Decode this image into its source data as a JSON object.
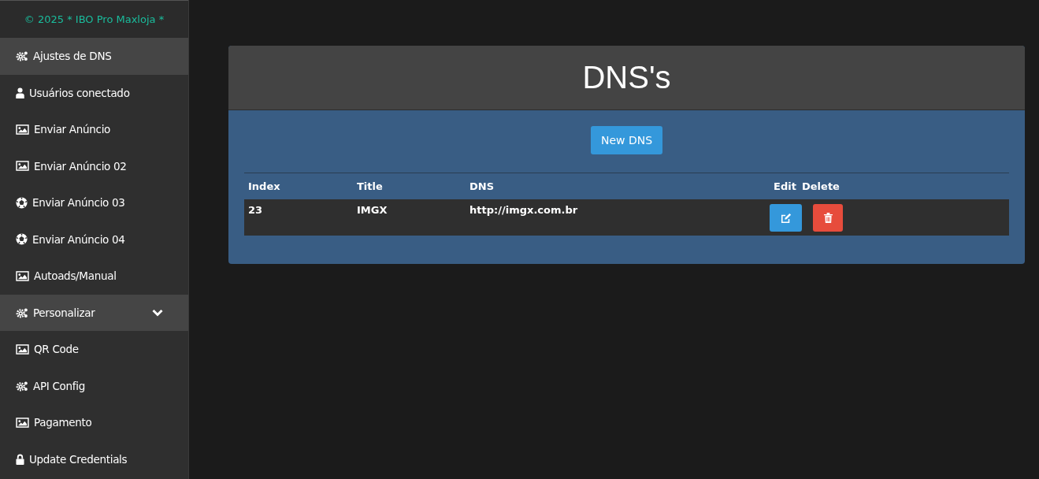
{
  "sidebar": {
    "brand": "© 2025 * IBO Pro Maxloja *",
    "items": [
      {
        "label": "Ajustes de DNS",
        "kind": "gears",
        "selected": true
      },
      {
        "label": "Usuários conectado",
        "kind": "user",
        "selected": false
      },
      {
        "label": "Enviar Anúncio",
        "kind": "image",
        "selected": false
      },
      {
        "label": "Enviar Anúncio 02",
        "kind": "image",
        "selected": false
      },
      {
        "label": "Enviar Anúncio 03",
        "kind": "ball",
        "selected": false
      },
      {
        "label": "Enviar Anúncio 04",
        "kind": "ball",
        "selected": false
      },
      {
        "label": "Autoads/Manual",
        "kind": "image",
        "selected": false
      },
      {
        "label": "Personalizar",
        "kind": "gears",
        "selected": true,
        "expandable": true
      },
      {
        "label": "QR Code",
        "kind": "image",
        "selected": false
      },
      {
        "label": "API Config",
        "kind": "gears",
        "selected": false
      },
      {
        "label": "Pagamento",
        "kind": "image",
        "selected": false
      },
      {
        "label": "Update Credentials",
        "kind": "lock",
        "selected": false
      }
    ]
  },
  "panel": {
    "title": "DNS's",
    "new_button": "New DNS",
    "table": {
      "columns": [
        "Index",
        "Title",
        "DNS",
        "Edit",
        "Delete"
      ],
      "rows": [
        {
          "index": "23",
          "title": "IMGX",
          "dns": "http://imgx.com.br"
        }
      ]
    }
  }
}
